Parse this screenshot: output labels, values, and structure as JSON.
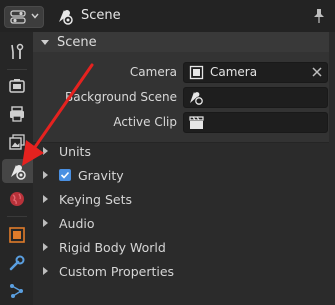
{
  "header": {
    "title": "Scene",
    "editor_icon": "properties-editor-icon",
    "title_icon": "scene-icon",
    "pin_icon": "pin-icon"
  },
  "sidebar": {
    "tabs": [
      {
        "name": "tool",
        "icon": "wrench-screwdriver-icon"
      },
      {
        "name": "render",
        "icon": "camera-render-icon"
      },
      {
        "name": "output",
        "icon": "printer-icon"
      },
      {
        "name": "view-layer",
        "icon": "image-stack-icon"
      },
      {
        "name": "scene",
        "icon": "scene-icon",
        "active": true
      },
      {
        "name": "world",
        "icon": "world-icon"
      },
      {
        "name": "object",
        "icon": "object-cube-icon"
      },
      {
        "name": "modifiers",
        "icon": "wrench-icon"
      },
      {
        "name": "particles",
        "icon": "particles-icon"
      }
    ]
  },
  "scene_panel": {
    "title": "Scene",
    "camera_label": "Camera",
    "camera_value": "Camera",
    "background_scene_label": "Background Scene",
    "background_scene_value": "",
    "active_clip_label": "Active Clip",
    "active_clip_value": ""
  },
  "sections": {
    "units": "Units",
    "gravity": "Gravity",
    "gravity_checked": true,
    "keying_sets": "Keying Sets",
    "audio": "Audio",
    "rigid_body_world": "Rigid Body World",
    "custom_properties": "Custom Properties"
  },
  "colors": {
    "arrow": "#e5221f",
    "checkbox": "#4a90e2"
  }
}
